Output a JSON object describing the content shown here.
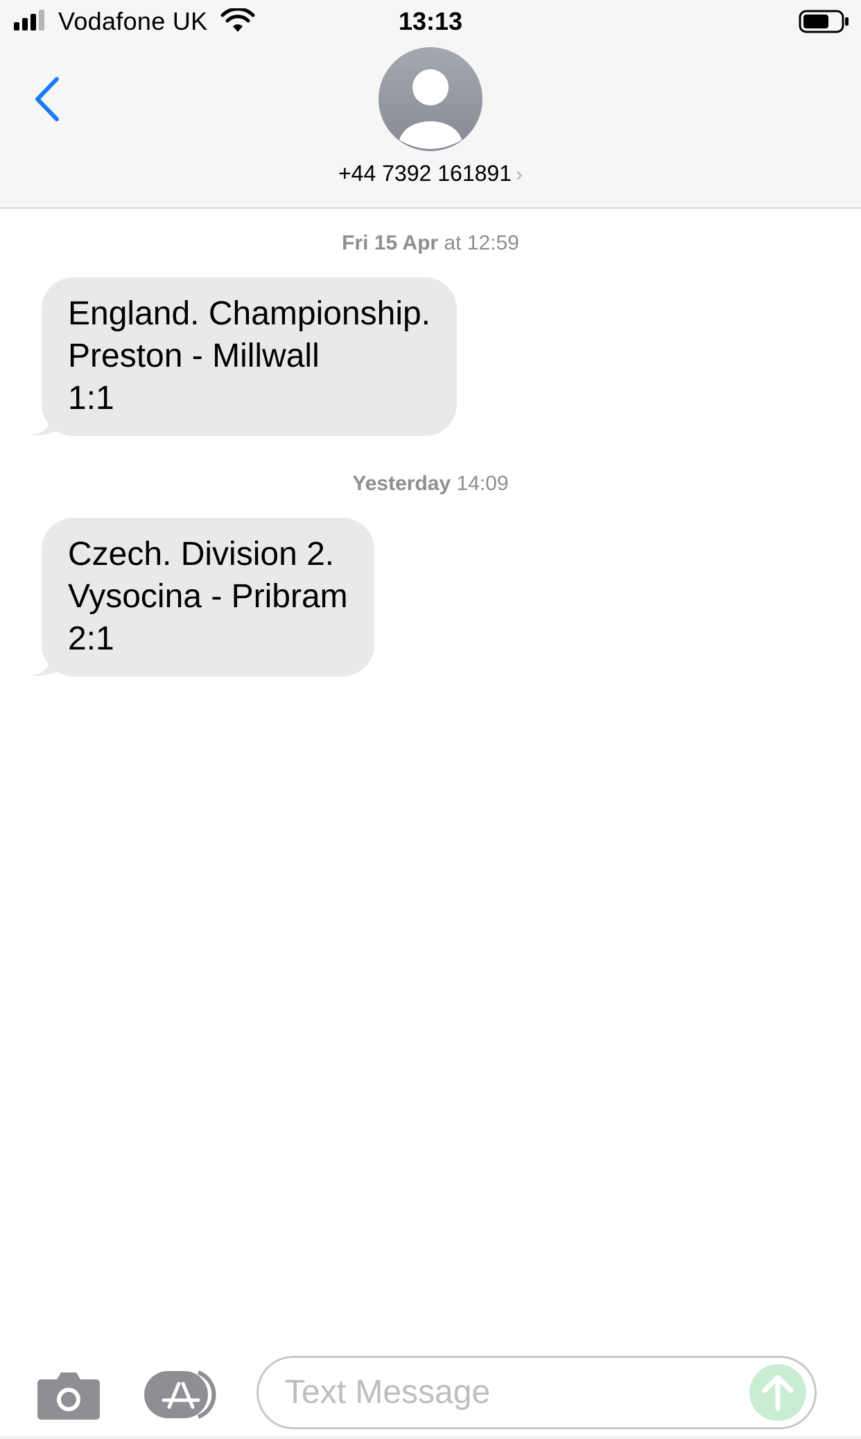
{
  "status_bar": {
    "carrier": "Vodafone UK",
    "time": "13:13"
  },
  "header": {
    "contact": "+44 7392 161891",
    "chevron": "›",
    "icons": [
      "back-chevron-icon",
      "person-avatar-icon"
    ]
  },
  "conversation": {
    "messages": [
      {
        "timestamp_day": "Fri 15 Apr",
        "timestamp_time": " at 12:59",
        "text": "England. Championship.\nPreston - Millwall\n1:1"
      },
      {
        "timestamp_day": "Yesterday",
        "timestamp_time": " 14:09",
        "text": "Czech. Division 2.\nVysocina - Pribram\n2:1"
      }
    ]
  },
  "input_bar": {
    "placeholder": "Text Message",
    "icons": [
      "camera-icon",
      "app-store-icon",
      "send-arrow-icon"
    ]
  },
  "colors": {
    "bubble": "#e9e9eb",
    "accent_blue": "#1a7cf5",
    "send_button": "#c9ecd3",
    "timestamp": "#8e8e93"
  }
}
